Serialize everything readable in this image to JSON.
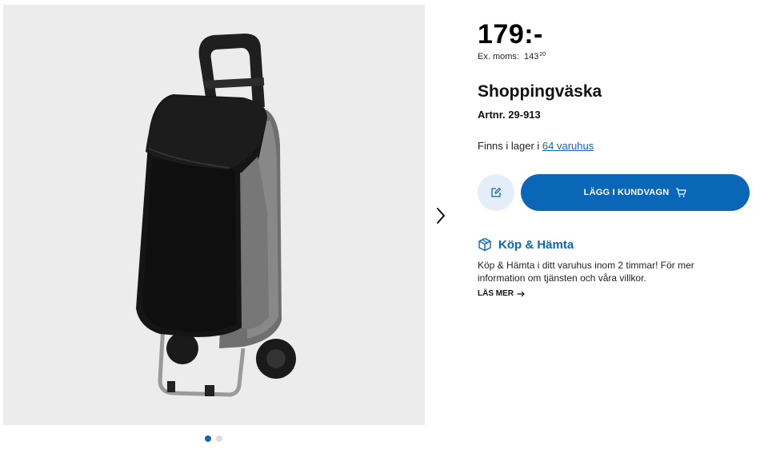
{
  "product": {
    "price": "179:-",
    "ex_moms_label": "Ex. moms:",
    "ex_moms_whole": "143",
    "ex_moms_decimals": "20",
    "title": "Shoppingväska",
    "article_number": "Artnr. 29-913",
    "stock_text": "Finns i lager i ",
    "stock_link": "64 varuhus"
  },
  "actions": {
    "edit_icon": "edit-icon",
    "add_to_cart_label": "LÄGG I KUNDVAGN",
    "cart_icon": "cart-icon"
  },
  "pickup": {
    "icon": "box-icon",
    "title": "Köp & Hämta",
    "description": "Köp & Hämta i ditt varuhus inom 2 timmar! För mer information om tjänsten och våra villkor.",
    "read_more": "LÄS MER"
  },
  "gallery": {
    "image": "shopping-trolley-bag",
    "active_index": 1,
    "total": 2
  },
  "colors": {
    "accent": "#0a66b7",
    "accent_light": "#e3eef9",
    "image_bg": "#ececec"
  }
}
